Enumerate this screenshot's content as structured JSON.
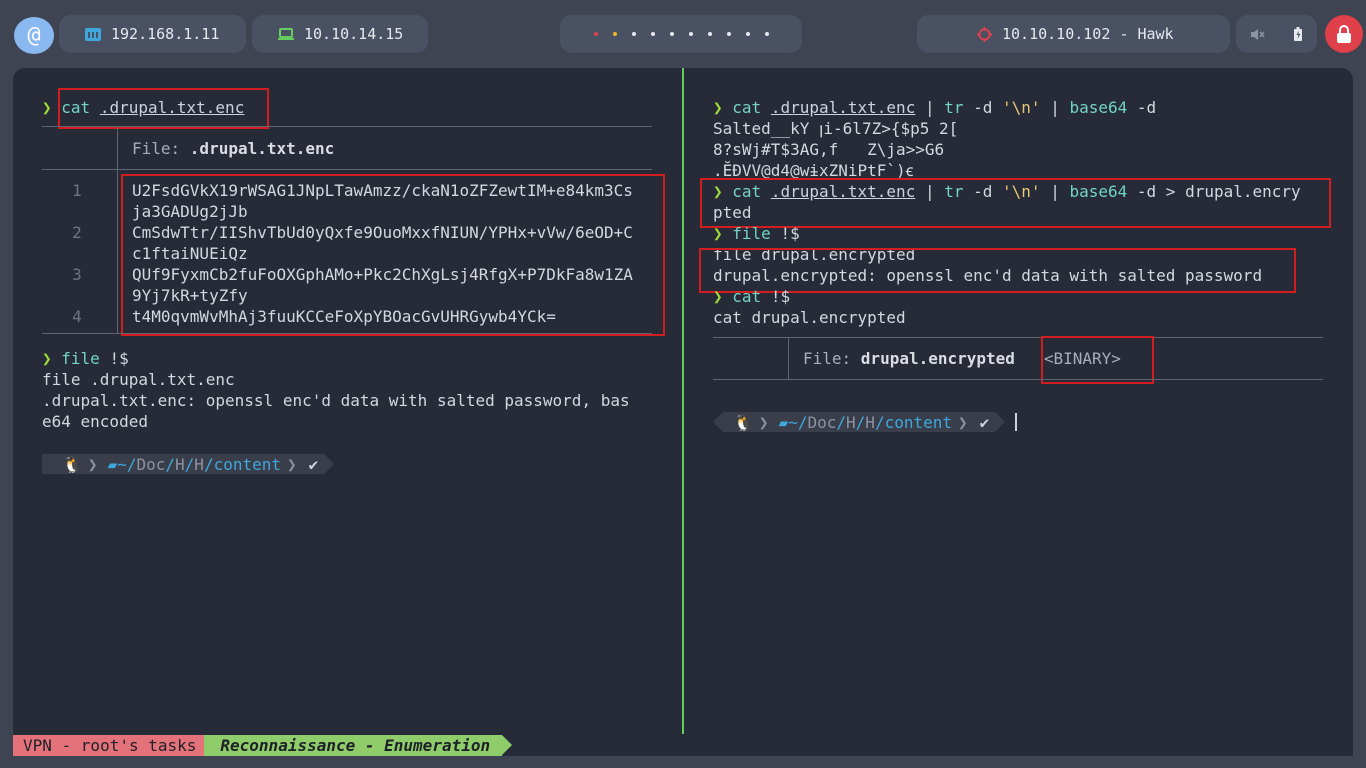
{
  "topbar": {
    "ip_local": "192.168.1.11",
    "ip_vpn": "10.10.14.15",
    "target": "10.10.10.102 - Hawk",
    "workspace_dots": 10,
    "dot_colors": [
      "#e0404a",
      "#f0b429",
      "#e6e9ef"
    ]
  },
  "left": {
    "prompt": "❯",
    "cmd1": "cat",
    "cmd1_arg": ".drupal.txt.enc",
    "file_label": "File: ",
    "file_name": ".drupal.txt.enc",
    "lines": [
      {
        "num": "1",
        "text1": "U2FsdGVkX19rWSAG1JNpLTawAmzz/ckaN1oZFZewtIM+e84km3Cs",
        "text2": "ja3GADUg2jJb"
      },
      {
        "num": "2",
        "text1": "CmSdwTtr/IIShvTbUd0yQxfe9OuoMxxfNIUN/YPHx+vVw/6eOD+C",
        "text2": "c1ftaiNUEiQz"
      },
      {
        "num": "3",
        "text1": "QUf9FyxmCb2fuFoOXGphAMo+Pkc2ChXgLsj4RfgX+P7DkFa8w1ZA",
        "text2": "9Yj7kR+tyZfy"
      },
      {
        "num": "4",
        "text1": "t4M0qvmWvMhAj3fuuKCCeFoXpYBOacGvUHRGywb4YCk=",
        "text2": ""
      }
    ],
    "cmd2": "file",
    "cmd2_arg": " !$",
    "echo2": "file .drupal.txt.enc",
    "out2a": ".drupal.txt.enc: openssl enc'd data with salted password, bas",
    "out2b": "e64 encoded",
    "pl_dir_home": "~/",
    "pl_dir_doc": "Doc",
    "pl_sep": "/",
    "pl_dir_h1": "H",
    "pl_dir_h2": "H",
    "pl_dir_content": "content",
    "pl_check": "✔"
  },
  "right": {
    "c1_cat": "cat",
    "c1_file": ".drupal.txt.enc",
    "c1_pipe": " | ",
    "c1_tr": "tr",
    "c1_trflag": " -d ",
    "c1_trarg": "'\\n'",
    "c1_b64": "base64",
    "c1_b64flag": " -d",
    "bin1": "Salted__kY ꞁi-6l7Z>{$p5 2[",
    "bin2": "8?sWj#T$3AG,f   Z\\ja>>G6",
    "bin3": ".ĔĐVV@d4@wɨxZNiPtF`)ꞓ",
    "c2_rest": " -d > drupal.encry",
    "c2_wrap": "pted",
    "c3_file": "file",
    "c3_arg": " !$",
    "echo3": "file drupal.encrypted",
    "out3": "drupal.encrypted: openssl enc'd data with salted password",
    "c4_cat": "cat",
    "c4_arg": " !$",
    "echo4": "cat drupal.encrypted",
    "file_label": "File: ",
    "file_name": "drupal.encrypted",
    "binary": "<BINARY>"
  },
  "status": {
    "session": "VPN - root's tasks",
    "window": "Reconnaissance - Enumeration"
  }
}
